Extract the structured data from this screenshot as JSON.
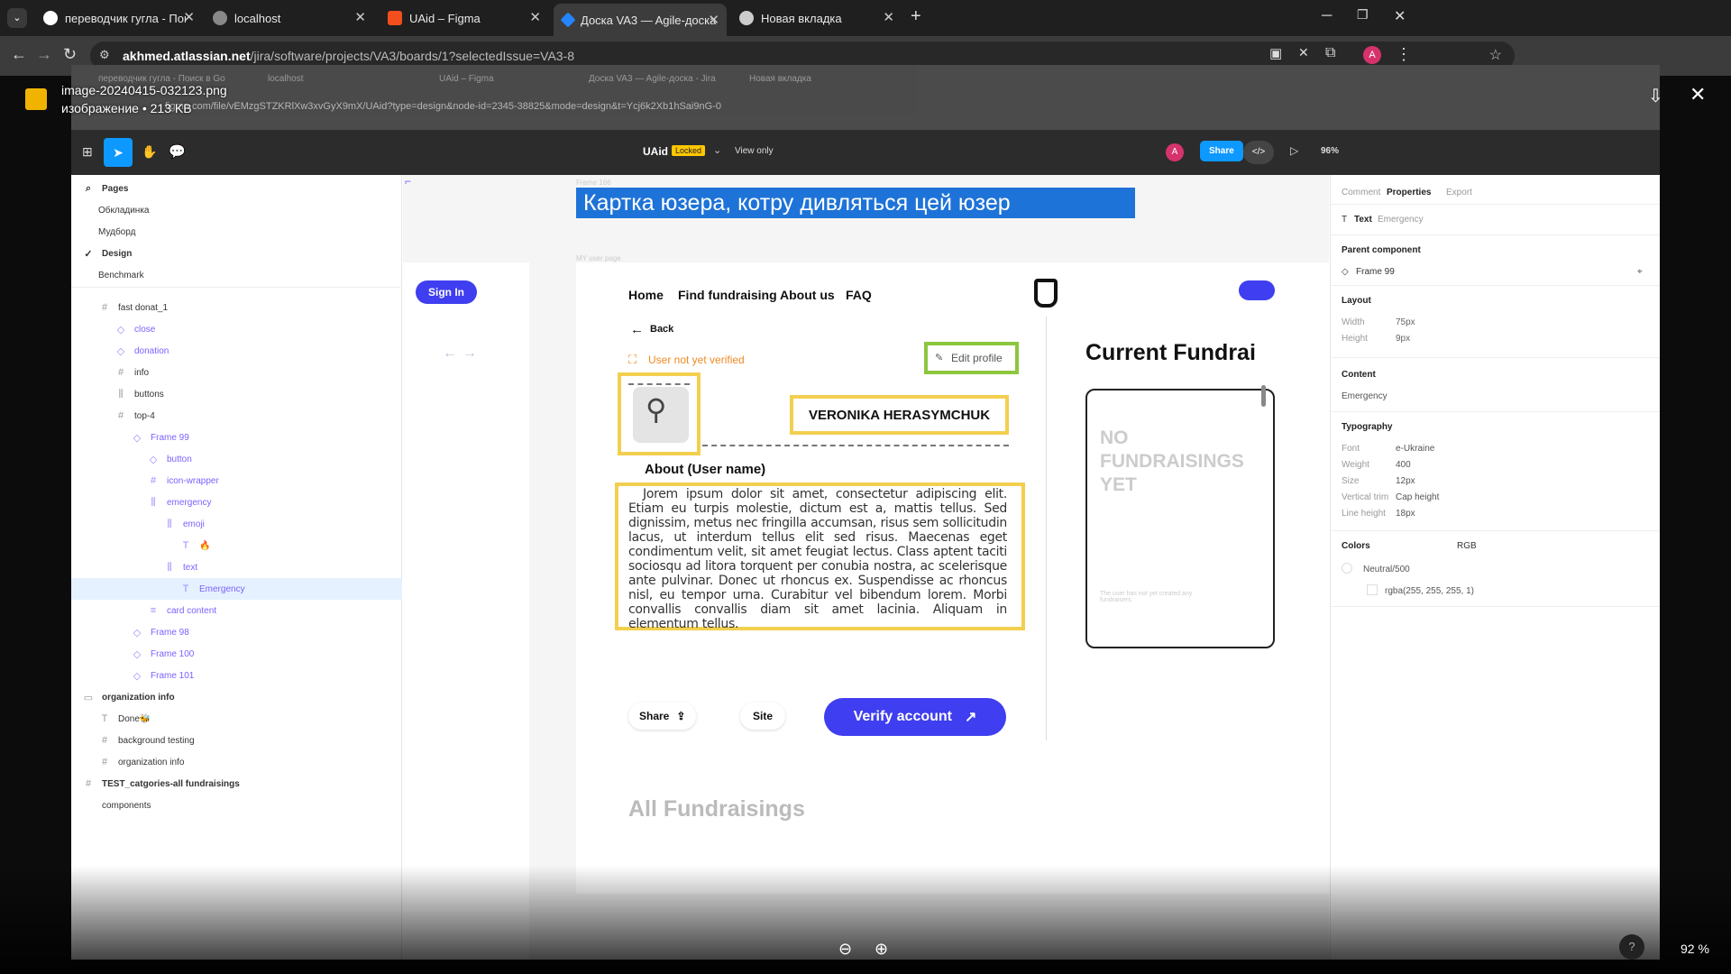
{
  "browser": {
    "tabs": [
      {
        "label": "переводчик гугла - Поиск в Go"
      },
      {
        "label": "localhost"
      },
      {
        "label": "UAid – Figma"
      },
      {
        "label": "Доска VA3 — Agile-доска - Jira"
      },
      {
        "label": "Новая вкладка"
      }
    ],
    "url_host": "akhmed.atlassian.net",
    "url_path": "/jira/software/projects/VA3/boards/1?selectedIssue=VA3-8"
  },
  "viewer": {
    "file_name": "image-20240415-032123.png",
    "file_meta": "изображение • 213 KB",
    "zoom": "92 %",
    "help": "?"
  },
  "shot": {
    "inner_tabs": [
      "переводчик гугла - Поиск в Go",
      "localhost",
      "UAid – Figma",
      "Доска VA3 — Agile-доска - Jira",
      "Новая вкладка"
    ],
    "inner_url": "figma.com/file/vEMzgSTZKRlXw3xvGyX9mX/UAid?type=design&node-id=2345-38825&mode=design&t=Ycj6k2Xb1hSai9nG-0",
    "figma": {
      "file_title": "UAid",
      "locked_badge": "Locked",
      "view_only": "View only",
      "share": "Share",
      "zoom": "96%",
      "avatar": "A"
    },
    "layers": {
      "pages_label": "Pages",
      "pages": [
        "Обкладинка",
        "Мудборд",
        "Design",
        "Benchmark"
      ],
      "tree": [
        {
          "label": "fast donat_1",
          "icon": "#"
        },
        {
          "label": "close",
          "icon": "◇"
        },
        {
          "label": "donation",
          "icon": "◇"
        },
        {
          "label": "info",
          "icon": "#"
        },
        {
          "label": "buttons",
          "icon": "⫼"
        },
        {
          "label": "top-4",
          "icon": "#"
        },
        {
          "label": "Frame 99",
          "icon": "◇"
        },
        {
          "label": "button",
          "icon": "◇"
        },
        {
          "label": "icon-wrapper",
          "icon": "#"
        },
        {
          "label": "emergency",
          "icon": "⫼"
        },
        {
          "label": "emoji",
          "icon": "⫼"
        },
        {
          "label": "🔥",
          "icon": "T"
        },
        {
          "label": "text",
          "icon": "⫼"
        },
        {
          "label": "Emergency",
          "icon": "T"
        },
        {
          "label": "card content",
          "icon": "≡"
        },
        {
          "label": "Frame 98",
          "icon": "◇"
        },
        {
          "label": "Frame 100",
          "icon": "◇"
        },
        {
          "label": "Frame 101",
          "icon": "◇"
        },
        {
          "label": "organization info",
          "icon": "▭"
        },
        {
          "label": "Done🐝",
          "icon": "T"
        },
        {
          "label": "background testing",
          "icon": "#"
        },
        {
          "label": "organization info",
          "icon": "#"
        },
        {
          "label": "TEST_catgories-all fundraisings",
          "icon": "#"
        },
        {
          "label": "components",
          "icon": ""
        }
      ]
    },
    "canvas": {
      "frame_label": "Frame 166",
      "banner": "Картка юзера, котру дивляться цей юзер",
      "page_label": "MY user page",
      "sign_in": "Sign In",
      "nav": [
        "Home",
        "Find fundraising",
        "About us",
        "FAQ"
      ],
      "back": "Back",
      "not_verified": "User not yet verified",
      "edit_profile": "Edit profile",
      "user_name": "VERONIKA HERASYMCHUK",
      "about_title": "About (User name)",
      "about_text": "Jorem ipsum dolor sit amet, consectetur adipiscing elit. Etiam eu turpis molestie, dictum est a, mattis tellus. Sed dignissim, metus nec fringilla accumsan, risus sem sollicitudin lacus, ut interdum tellus elit sed risus. Maecenas eget condimentum velit, sit amet feugiat lectus. Class aptent taciti sociosqu ad litora torquent per conubia nostra, ac scelerisque ante pulvinar. Donec ut rhoncus ex. Suspendisse ac rhoncus nisl, eu tempor urna. Curabitur vel bibendum lorem. Morbi convallis convallis diam sit amet lacinia. Aliquam in elementum tellus.",
      "current_fundraisings": "Current Fundrai",
      "no_fundraisings": "NO FUNDRAISINGS YET",
      "no_fundraisings_sub": "The user has not yet created any fundraisers.",
      "share": "Share",
      "site": "Site",
      "verify": "Verify account",
      "all_fundraisings": "All Fundraisings"
    },
    "props": {
      "tabs": [
        "Comment",
        "Properties",
        "Export"
      ],
      "text_label": "Text",
      "text_value": "Emergency",
      "parent_component": "Parent component",
      "parent_value": "Frame 99",
      "layout": "Layout",
      "width_label": "Width",
      "width_value": "75px",
      "height_label": "Height",
      "height_value": "9px",
      "content": "Content",
      "content_value": "Emergency",
      "typography": "Typography",
      "font_label": "Font",
      "font_value": "e-Ukraine",
      "weight_label": "Weight",
      "weight_value": "400",
      "size_label": "Size",
      "size_value": "12px",
      "vtrim_label": "Vertical trim",
      "vtrim_value": "Cap height",
      "lh_label": "Line height",
      "lh_value": "18px",
      "colors": "Colors",
      "color_mode": "RGB",
      "color_name": "Neutral/500",
      "color_value": "rgba(255, 255, 255, 1)"
    }
  },
  "colors": {
    "figma_blue": "#0d99ff",
    "cta_blue": "#3f3ef0",
    "highlight_yellow": "#f3cf4f",
    "highlight_green": "#8dc63f",
    "warning_orange": "#f08a24"
  }
}
